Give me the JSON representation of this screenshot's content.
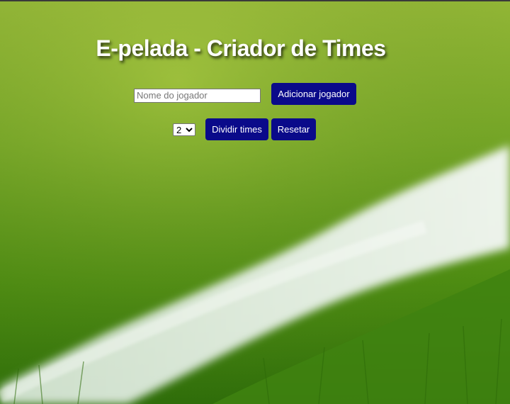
{
  "header": {
    "title": "E-pelada - Criador de Times"
  },
  "player_form": {
    "name_placeholder": "Nome do jogador",
    "name_value": "",
    "add_label": "Adicionar jogador"
  },
  "team_controls": {
    "team_count_selected": "2",
    "team_count_options": [
      "2"
    ],
    "divide_label": "Dividir times",
    "reset_label": "Resetar"
  },
  "theme": {
    "button_color": "#0a0a8a",
    "background": "soccer-field-grass-image"
  }
}
